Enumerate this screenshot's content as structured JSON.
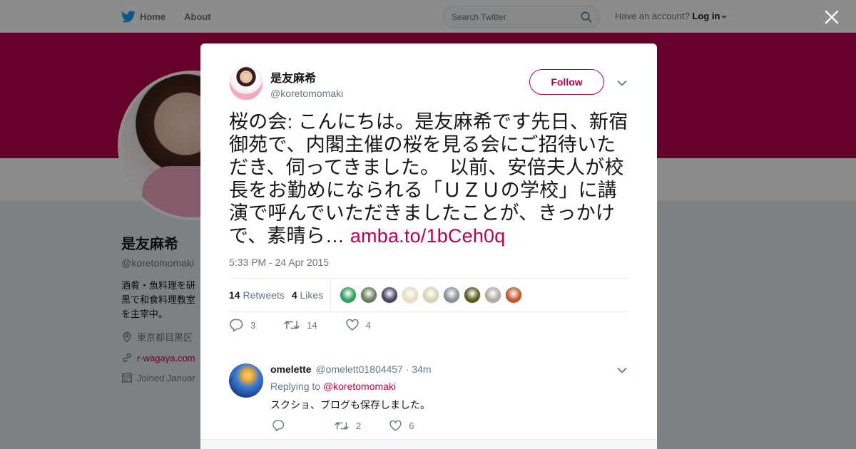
{
  "topbar": {
    "home_label": "Home",
    "about_label": "About",
    "search_placeholder": "Search Twitter",
    "account_prompt": "Have an account?",
    "login_label": "Log in"
  },
  "profile": {
    "name": "是友麻希",
    "handle": "@koretomomaki",
    "bio": "酒肴・魚料理を研\n黒で和食料理教室\nを主宰中。",
    "location": "東京都目黒区",
    "website": "r-wagaya.com",
    "joined": "Joined Januar"
  },
  "tweet": {
    "author_name": "是友麻希",
    "author_handle": "@koretomomaki",
    "follow_label": "Follow",
    "text": "桜の会: こんにちは。是友麻希です先日、新宿御苑で、内閣主催の桜を見る会にご招待いただき、伺ってきました。　以前、安倍夫人が校長をお勤めになられる「ＵＺＵの学校」に講演で呼んでいただきましたことが、きっかけで、素晴ら… ",
    "link": "amba.to/1bCeh0q",
    "timestamp": "5:33 PM - 24 Apr 2015",
    "retweets_count": "14",
    "retweets_label": "Retweets",
    "likes_count": "4",
    "likes_label": "Likes",
    "reply_count": "3",
    "retweet_action_count": "14",
    "like_action_count": "4"
  },
  "likers": [
    {
      "color": "#2e9e5a"
    },
    {
      "color": "#6b7a5c"
    },
    {
      "color": "#4a4460"
    },
    {
      "color": "#e9dcc0"
    },
    {
      "color": "#d9d1b0"
    },
    {
      "color": "#8a8f9a"
    },
    {
      "color": "#5a5a20"
    },
    {
      "color": "#b5a89c"
    },
    {
      "color": "#c0542a"
    }
  ],
  "reply": {
    "name": "omelette",
    "handle": "@omelett01804457",
    "time": "· 34m",
    "replying_prefix": "Replying to",
    "replying_to": "@koretomomaki",
    "text": "スクショ、ブログも保存しました。",
    "reply_count": "",
    "retweet_count": "2",
    "like_count": "6"
  },
  "colors": {
    "accent": "#b8004f",
    "twitter_blue": "#1da1f2"
  }
}
